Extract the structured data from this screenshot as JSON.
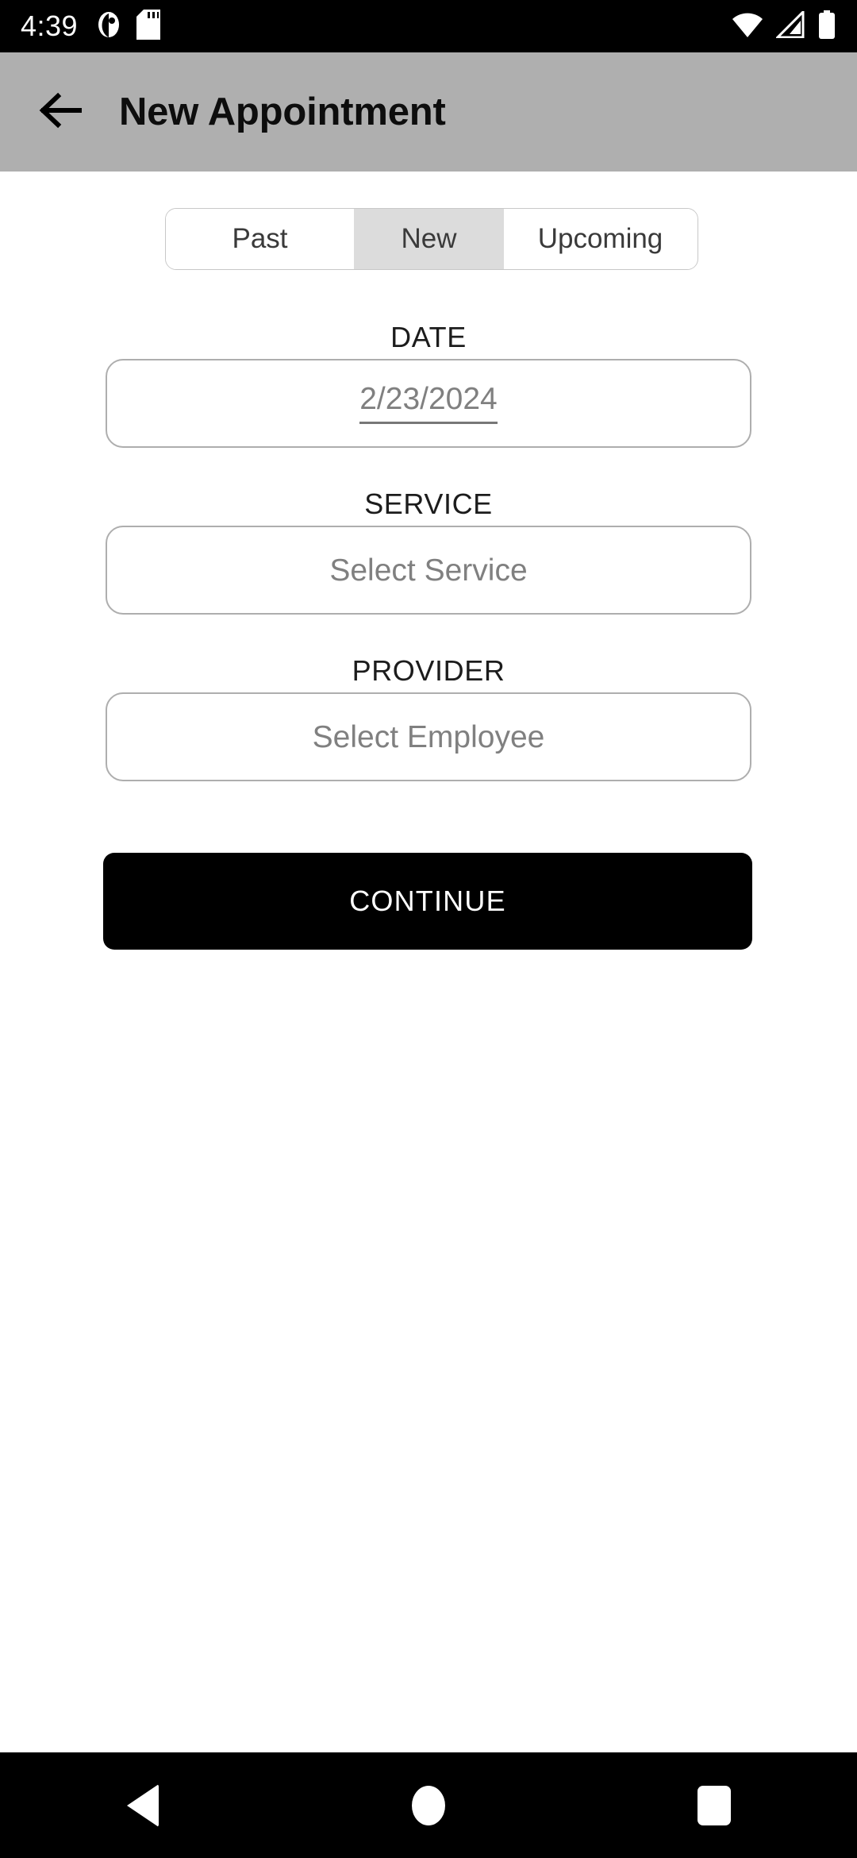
{
  "status_bar": {
    "clock": "4:39",
    "left_icons": [
      "do-not-disturb-icon",
      "sd-card-icon"
    ],
    "right_icons": [
      "wifi-icon",
      "cellular-signal-icon",
      "battery-icon"
    ],
    "background_color": "#000000"
  },
  "app_bar": {
    "back_icon": "back-arrow-icon",
    "title": "New Appointment",
    "background_color": "#afafaf",
    "title_color": "#0d0d0d"
  },
  "segmented_control": {
    "selected": "New",
    "segments": [
      {
        "label": "Past",
        "selected": false
      },
      {
        "label": "New",
        "selected": true
      },
      {
        "label": "Upcoming",
        "selected": false
      }
    ],
    "selected_background": "#dcdcdc",
    "border_color": "#c8c8c8"
  },
  "form": {
    "fields": [
      {
        "label": "DATE",
        "value": "2/23/2024",
        "placeholder": "2/23/2024",
        "underlined": true
      },
      {
        "label": "SERVICE",
        "value": "Select Service",
        "placeholder": "Select Service",
        "underlined": false
      },
      {
        "label": "PROVIDER",
        "value": "Select Employee",
        "placeholder": "Select Employee",
        "underlined": false
      }
    ],
    "field_border_color": "#aeaeae",
    "value_text_color": "#808080"
  },
  "primary_action": {
    "label": "CONTINUE",
    "background_color": "#000000",
    "text_color": "#ffffff"
  },
  "nav_bar": {
    "background_color": "#000000",
    "buttons": [
      {
        "name": "back",
        "icon": "nav-back-triangle-icon"
      },
      {
        "name": "home",
        "icon": "nav-home-circle-icon"
      },
      {
        "name": "recents",
        "icon": "nav-recents-square-icon"
      }
    ]
  }
}
